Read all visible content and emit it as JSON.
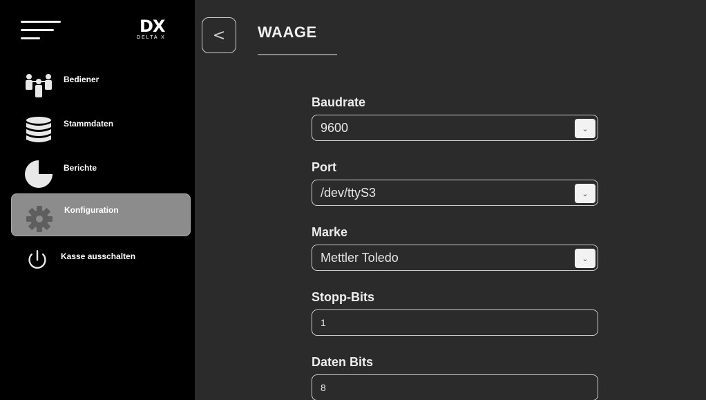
{
  "logo": {
    "mark": "DX",
    "wordmark": "DELTA X"
  },
  "sidebar": {
    "items": [
      {
        "label": "Bediener",
        "icon": "users-icon",
        "active": false
      },
      {
        "label": "Stammdaten",
        "icon": "database-icon",
        "active": false
      },
      {
        "label": "Berichte",
        "icon": "pie-chart-icon",
        "active": false
      },
      {
        "label": "Konfiguration",
        "icon": "gear-icon",
        "active": true
      },
      {
        "label": "Kasse ausschalten",
        "icon": "power-icon",
        "active": false
      }
    ]
  },
  "header": {
    "back_glyph": "<",
    "title": "WAAGE"
  },
  "form": {
    "fields": [
      {
        "label": "Baudrate",
        "value": "9600",
        "type": "select"
      },
      {
        "label": "Port",
        "value": "/dev/ttyS3",
        "type": "select"
      },
      {
        "label": "Marke",
        "value": "Mettler Toledo",
        "type": "select"
      },
      {
        "label": "Stopp-Bits",
        "value": "1",
        "type": "input"
      },
      {
        "label": "Daten Bits",
        "value": "8",
        "type": "input"
      }
    ],
    "dropdown_glyph": "⌄"
  },
  "colors": {
    "sidebar_bg": "#000000",
    "main_bg": "#2b2b2b",
    "active_item_bg": "#8c8c8c"
  }
}
